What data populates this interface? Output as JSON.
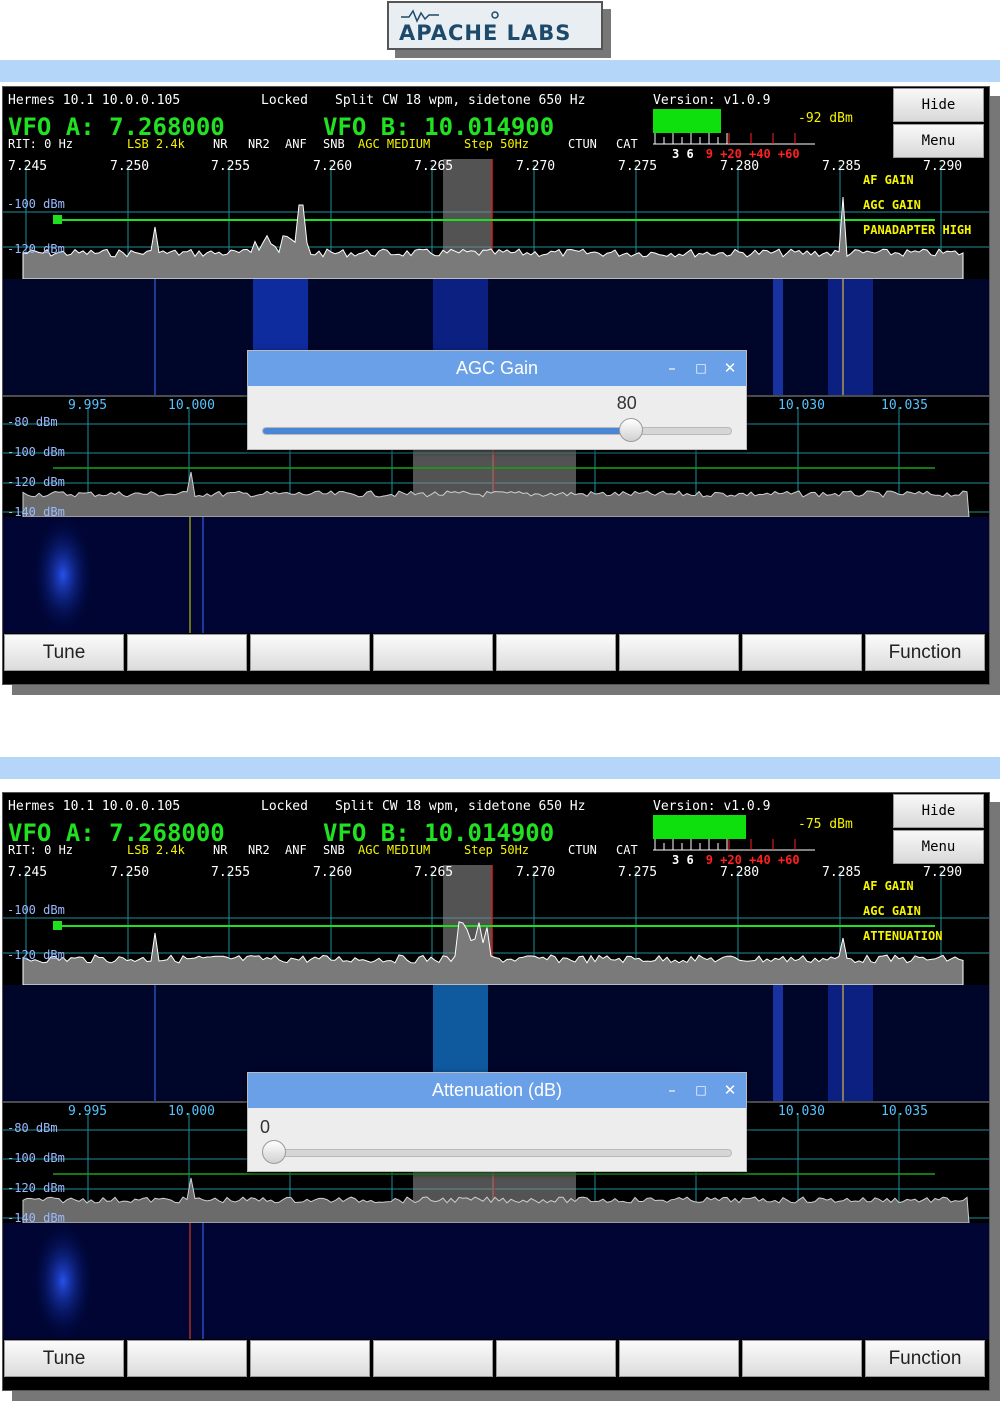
{
  "logo": {
    "text": "APACHE LABS"
  },
  "colors": {
    "band": "#b3d6f9",
    "vfo": "#22e022",
    "label": "#f5f500",
    "meter": "#0ee00e",
    "dialog_title": "#6aa0e8"
  },
  "screens": [
    {
      "status": {
        "radio": "Hermes 10.1 10.0.0.105",
        "lock": "Locked",
        "split": "Split CW 18 wpm, sidetone 650 Hz",
        "version": "Version: v1.0.9"
      },
      "vfo_a": "VFO A: 7.268000",
      "vfo_b": "VFO B: 10.014900",
      "modes": {
        "rit": "RIT: 0 Hz",
        "mode": "LSB 2.4k",
        "nr": "NR",
        "nr2": "NR2",
        "anf": "ANF",
        "snb": "SNB",
        "agc": "AGC MEDIUM",
        "step": "Step 50Hz",
        "ctun": "CTUN",
        "cat": "CAT"
      },
      "meter": {
        "level": 0.45,
        "dbm": "-92 dBm",
        "scale_white": "3 6",
        "scale_red": "9 +20 +40 +60"
      },
      "buttons": {
        "hide": "Hide",
        "menu": "Menu"
      },
      "pan1_freqs": [
        "7.245",
        "7.250",
        "7.255",
        "7.260",
        "7.265",
        "7.270",
        "7.275",
        "7.280",
        "7.285",
        "7.290"
      ],
      "pan1_db": [
        "-100 dBm",
        "-120 dBm"
      ],
      "pan_labels": [
        "AF GAIN",
        "AGC GAIN",
        "PANADAPTER HIGH"
      ],
      "pan2_freqs": [
        "9.995",
        "10.000",
        "10.030",
        "10.035"
      ],
      "pan2_db": [
        "-80 dBm",
        "-100 dBm",
        "-120 dBm",
        "-140 dBm"
      ],
      "dialog": {
        "title": "AGC Gain",
        "value": "80",
        "fraction": 0.8,
        "min_icon": "minimize-icon",
        "max_icon": "maximize-icon",
        "close_icon": "close-icon"
      },
      "bottom": [
        "Tune",
        "",
        "",
        "",
        "",
        "",
        "",
        "Function"
      ]
    },
    {
      "status": {
        "radio": "Hermes 10.1 10.0.0.105",
        "lock": "Locked",
        "split": "Split CW 18 wpm, sidetone 650 Hz",
        "version": "Version: v1.0.9"
      },
      "vfo_a": "VFO A: 7.268000",
      "vfo_b": "VFO B: 10.014900",
      "modes": {
        "rit": "RIT: 0 Hz",
        "mode": "LSB 2.4k",
        "nr": "NR",
        "nr2": "NR2",
        "anf": "ANF",
        "snb": "SNB",
        "agc": "AGC MEDIUM",
        "step": "Step 50Hz",
        "ctun": "CTUN",
        "cat": "CAT"
      },
      "meter": {
        "level": 0.62,
        "dbm": "-75 dBm",
        "scale_white": "3 6",
        "scale_red": "9 +20 +40 +60"
      },
      "buttons": {
        "hide": "Hide",
        "menu": "Menu"
      },
      "pan1_freqs": [
        "7.245",
        "7.250",
        "7.255",
        "7.260",
        "7.265",
        "7.270",
        "7.275",
        "7.280",
        "7.285",
        "7.290"
      ],
      "pan1_db": [
        "-100 dBm",
        "-120 dBm"
      ],
      "pan_labels": [
        "AF GAIN",
        "AGC GAIN",
        "ATTENUATION"
      ],
      "pan2_freqs": [
        "9.995",
        "10.000",
        "10.030",
        "10.035"
      ],
      "pan2_db": [
        "-80 dBm",
        "-100 dBm",
        "-120 dBm",
        "-140 dBm"
      ],
      "dialog": {
        "title": "Attenuation (dB)",
        "value": "0",
        "fraction": 0.0,
        "min_icon": "minimize-icon",
        "max_icon": "maximize-icon",
        "close_icon": "close-icon"
      },
      "bottom": [
        "Tune",
        "",
        "",
        "",
        "",
        "",
        "",
        "Function"
      ]
    }
  ]
}
